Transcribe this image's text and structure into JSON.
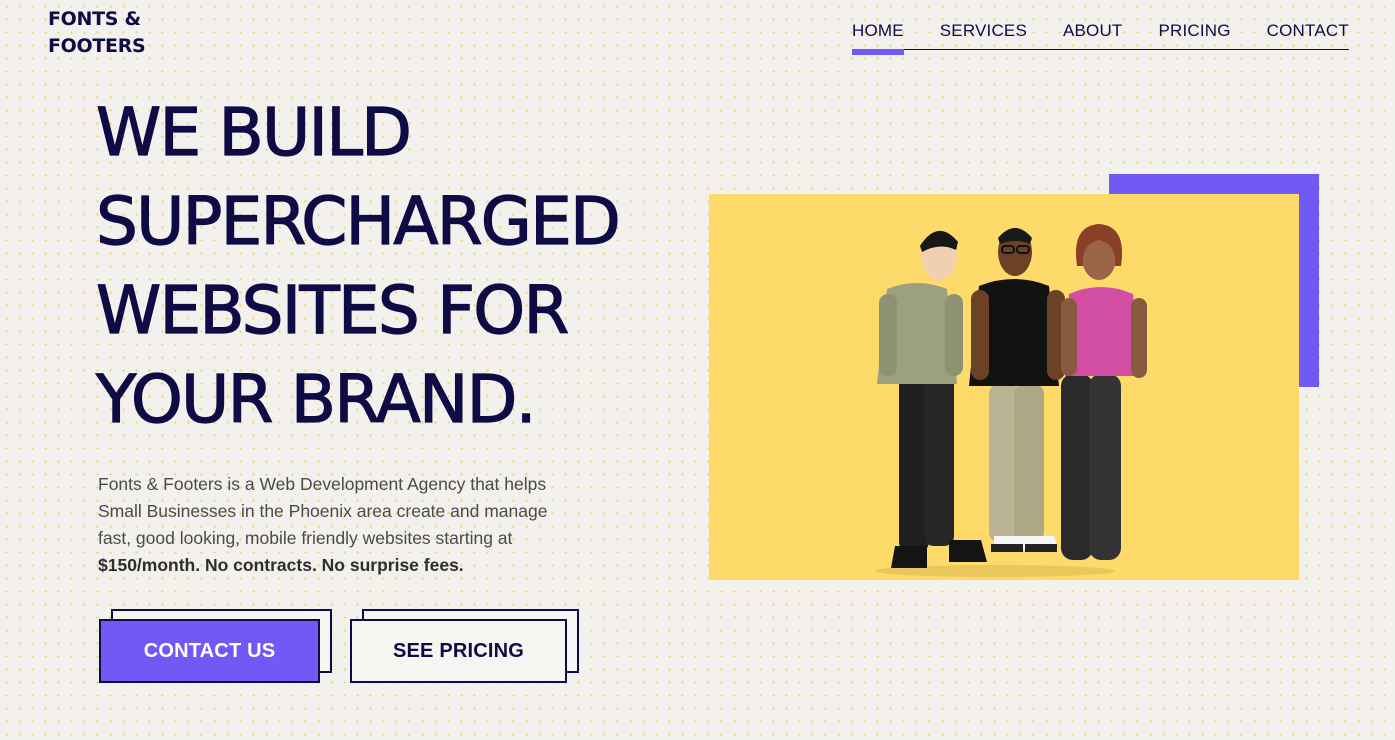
{
  "brand": {
    "line1": "FONTS &",
    "line2": "FOOTERS"
  },
  "nav": {
    "items": [
      {
        "label": "HOME",
        "active": true
      },
      {
        "label": "SERVICES",
        "active": false
      },
      {
        "label": "ABOUT",
        "active": false
      },
      {
        "label": "PRICING",
        "active": false
      },
      {
        "label": "CONTACT",
        "active": false
      }
    ]
  },
  "hero": {
    "headline": [
      "WE BUILD",
      "SUPERCHARGED",
      "WEBSITES FOR",
      "YOUR BRAND."
    ],
    "description": "Fonts & Footers is a Web Development Agency that helps Small Businesses in the Phoenix area create and manage fast, good looking, mobile friendly websites starting at",
    "description_bold": "$150/month. No contracts. No surprise fees.",
    "image_icon": "three-people-illustration"
  },
  "buttons": {
    "contact": "CONTACT US",
    "pricing": "SEE PRICING"
  },
  "colors": {
    "accent": "#7159f5",
    "navy": "#0e0b45",
    "yellow": "#fdda69",
    "background": "#f3f1ed",
    "dot": "#f1d57a"
  }
}
